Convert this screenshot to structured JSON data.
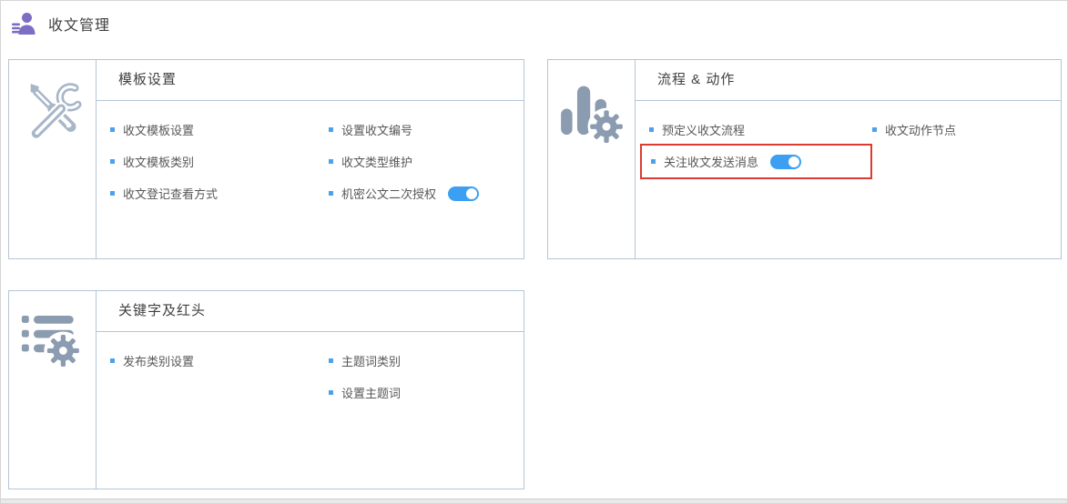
{
  "header": {
    "title": "收文管理"
  },
  "cards": [
    {
      "title": "模板设置",
      "icon": "crossed-tools-icon",
      "links": {
        "col1": [
          "收文模板设置",
          "收文模板类别",
          "收文登记查看方式"
        ],
        "col2": [
          "设置收文编号",
          "收文类型维护",
          "机密公文二次授权"
        ]
      },
      "toggles": [
        {
          "label": "机密公文二次授权",
          "state": "on"
        }
      ]
    },
    {
      "title": "流程 & 动作",
      "icon": "bar-chart-gear-icon",
      "links": {
        "col1": [
          "预定义收文流程",
          "关注收文发送消息"
        ],
        "col2": [
          "收文动作节点"
        ]
      },
      "toggles": [
        {
          "label": "关注收文发送消息",
          "state": "on"
        }
      ],
      "highlight": {
        "label": "关注收文发送消息",
        "border_color": "#dc3b31"
      }
    },
    {
      "title": "关键字及红头",
      "icon": "list-gear-icon",
      "links": {
        "col1": [
          "发布类别设置"
        ],
        "col2": [
          "主题词类别",
          "设置主题词"
        ]
      }
    }
  ],
  "colors": {
    "header_icon_purple": "#7d6ec4",
    "card_border": "#b5c5d6",
    "outline_icon_gray": "#a7b6c8",
    "solid_icon_gray": "#8b9cb0",
    "link_text": "#585858",
    "bullet_blue": "#4ca1ea",
    "toggle_on_blue": "#3d9ff2",
    "highlight_red": "#dc3b31"
  }
}
